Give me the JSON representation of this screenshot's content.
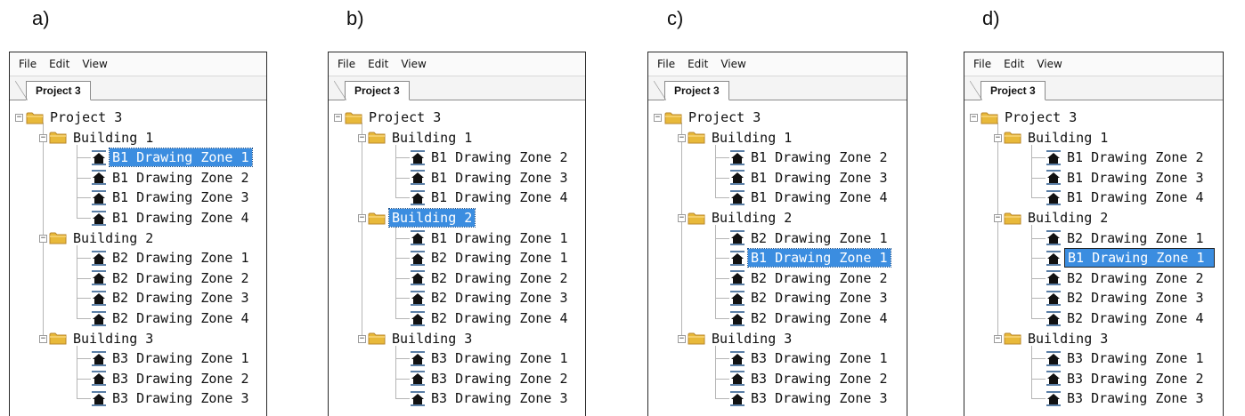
{
  "panels": [
    {
      "caption": "a)",
      "menu": [
        "File",
        "Edit",
        "View"
      ],
      "tab": "Project 3",
      "tree": [
        {
          "label": "Project 3",
          "type": "root",
          "state": ""
        },
        {
          "label": "Building 1",
          "type": "folder",
          "state": ""
        },
        {
          "label": "B1 Drawing Zone 1",
          "type": "zone",
          "state": "selected"
        },
        {
          "label": "B1 Drawing Zone 2",
          "type": "zone",
          "state": ""
        },
        {
          "label": "B1 Drawing Zone 3",
          "type": "zone",
          "state": ""
        },
        {
          "label": "B1 Drawing Zone 4",
          "type": "zone",
          "state": ""
        },
        {
          "label": "Building 2",
          "type": "folder",
          "state": ""
        },
        {
          "label": "B2 Drawing Zone 1",
          "type": "zone",
          "state": ""
        },
        {
          "label": "B2 Drawing Zone 2",
          "type": "zone",
          "state": ""
        },
        {
          "label": "B2 Drawing Zone 3",
          "type": "zone",
          "state": ""
        },
        {
          "label": "B2 Drawing Zone 4",
          "type": "zone",
          "state": ""
        },
        {
          "label": "Building 3",
          "type": "folder",
          "state": ""
        },
        {
          "label": "B3 Drawing Zone 1",
          "type": "zone",
          "state": ""
        },
        {
          "label": "B3 Drawing Zone 2",
          "type": "zone",
          "state": ""
        },
        {
          "label": "B3 Drawing Zone 3",
          "type": "zone",
          "state": ""
        }
      ]
    },
    {
      "caption": "b)",
      "menu": [
        "File",
        "Edit",
        "View"
      ],
      "tab": "Project 3",
      "tree": [
        {
          "label": "Project 3",
          "type": "root",
          "state": ""
        },
        {
          "label": "Building 1",
          "type": "folder",
          "state": ""
        },
        {
          "label": "B1 Drawing Zone 2",
          "type": "zone",
          "state": ""
        },
        {
          "label": "B1 Drawing Zone 3",
          "type": "zone",
          "state": ""
        },
        {
          "label": "B1 Drawing Zone 4",
          "type": "zone",
          "state": ""
        },
        {
          "label": "Building 2",
          "type": "folder",
          "state": "selected"
        },
        {
          "label": "B1 Drawing Zone 1",
          "type": "zone",
          "state": ""
        },
        {
          "label": "B2 Drawing Zone 1",
          "type": "zone",
          "state": ""
        },
        {
          "label": "B2 Drawing Zone 2",
          "type": "zone",
          "state": ""
        },
        {
          "label": "B2 Drawing Zone 3",
          "type": "zone",
          "state": ""
        },
        {
          "label": "B2 Drawing Zone 4",
          "type": "zone",
          "state": ""
        },
        {
          "label": "Building 3",
          "type": "folder",
          "state": ""
        },
        {
          "label": "B3 Drawing Zone 1",
          "type": "zone",
          "state": ""
        },
        {
          "label": "B3 Drawing Zone 2",
          "type": "zone",
          "state": ""
        },
        {
          "label": "B3 Drawing Zone 3",
          "type": "zone",
          "state": ""
        }
      ]
    },
    {
      "caption": "c)",
      "menu": [
        "File",
        "Edit",
        "View"
      ],
      "tab": "Project 3",
      "tree": [
        {
          "label": "Project 3",
          "type": "root",
          "state": ""
        },
        {
          "label": "Building 1",
          "type": "folder",
          "state": ""
        },
        {
          "label": "B1 Drawing Zone 2",
          "type": "zone",
          "state": ""
        },
        {
          "label": "B1 Drawing Zone 3",
          "type": "zone",
          "state": ""
        },
        {
          "label": "B1 Drawing Zone 4",
          "type": "zone",
          "state": ""
        },
        {
          "label": "Building 2",
          "type": "folder",
          "state": ""
        },
        {
          "label": "B2 Drawing Zone 1",
          "type": "zone",
          "state": ""
        },
        {
          "label": "B1 Drawing Zone 1",
          "type": "zone",
          "state": "selected"
        },
        {
          "label": "B2 Drawing Zone 2",
          "type": "zone",
          "state": ""
        },
        {
          "label": "B2 Drawing Zone 3",
          "type": "zone",
          "state": ""
        },
        {
          "label": "B2 Drawing Zone 4",
          "type": "zone",
          "state": ""
        },
        {
          "label": "Building 3",
          "type": "folder",
          "state": ""
        },
        {
          "label": "B3 Drawing Zone 1",
          "type": "zone",
          "state": ""
        },
        {
          "label": "B3 Drawing Zone 2",
          "type": "zone",
          "state": ""
        },
        {
          "label": "B3 Drawing Zone 3",
          "type": "zone",
          "state": ""
        }
      ]
    },
    {
      "caption": "d)",
      "menu": [
        "File",
        "Edit",
        "View"
      ],
      "tab": "Project 3",
      "tree": [
        {
          "label": "Project 3",
          "type": "root",
          "state": ""
        },
        {
          "label": "Building 1",
          "type": "folder",
          "state": ""
        },
        {
          "label": "B1 Drawing Zone 2",
          "type": "zone",
          "state": ""
        },
        {
          "label": "B1 Drawing Zone 3",
          "type": "zone",
          "state": ""
        },
        {
          "label": "B1 Drawing Zone 4",
          "type": "zone",
          "state": ""
        },
        {
          "label": "Building 2",
          "type": "folder",
          "state": ""
        },
        {
          "label": "B2 Drawing Zone 1",
          "type": "zone",
          "state": ""
        },
        {
          "label": "B1 Drawing Zone 1",
          "type": "zone",
          "state": "editing"
        },
        {
          "label": "B2 Drawing Zone 2",
          "type": "zone",
          "state": ""
        },
        {
          "label": "B2 Drawing Zone 3",
          "type": "zone",
          "state": ""
        },
        {
          "label": "B2 Drawing Zone 4",
          "type": "zone",
          "state": ""
        },
        {
          "label": "Building 3",
          "type": "folder",
          "state": ""
        },
        {
          "label": "B3 Drawing Zone 1",
          "type": "zone",
          "state": ""
        },
        {
          "label": "B3 Drawing Zone 2",
          "type": "zone",
          "state": ""
        },
        {
          "label": "B3 Drawing Zone 3",
          "type": "zone",
          "state": ""
        }
      ]
    }
  ],
  "colors": {
    "selection": "#3b8de0",
    "folder": "#e8b93a",
    "zone_icon": "#111111"
  },
  "icons": {
    "root": "folder-icon",
    "folder": "folder-icon",
    "zone": "drawing-zone-house-icon",
    "expander": "collapse-minus-icon"
  }
}
